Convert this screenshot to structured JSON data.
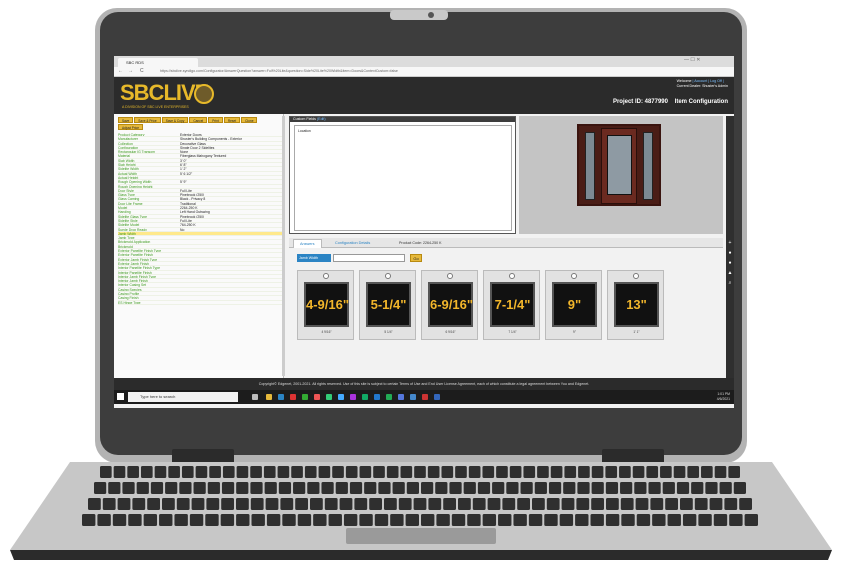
{
  "browser": {
    "tab_title": "SBC RDS",
    "url": "https://sbclive.syndigo.com/Configurator/AnswerQuestion?answer=Full%20Lite&question=Side%20Lite%20Width&item=Doors&ContextCustom=false",
    "back_glyph": "←",
    "forward_glyph": "→",
    "refresh_glyph": "C",
    "window_controls": "—   ☐   ✕"
  },
  "header": {
    "logo_text": "SBCLIVE",
    "logo_tagline": "A DIVISION OF SBC LIVE ENTERPRISES",
    "welcome": "Welcome",
    "account_links": "| Account | Log Off |",
    "current_dealer": "Current Dealer: Shuster's Admin",
    "project_id": "Project ID: 4877990",
    "item_configuration": "Item Configuration"
  },
  "toolbar": {
    "buttons": [
      "Save",
      "Save & Price",
      "Save & Copy",
      "Cancel",
      "Print",
      "Reset",
      "Clone",
      "Adjust Price"
    ]
  },
  "properties": [
    {
      "key": "Product Category",
      "value": "Exterior Doors"
    },
    {
      "key": "Manufacturer",
      "value": "Shuster's Building Components - Exterior"
    },
    {
      "key": "Collection",
      "value": "Decorative Glass"
    },
    {
      "key": "Configuration",
      "value": "Single Door 2 Sidelites"
    },
    {
      "key": "Rectangular IG Transom",
      "value": "None"
    },
    {
      "key": "Material",
      "value": "Fiberglass Mahogany Textured"
    },
    {
      "key": "Slab Width",
      "value": "3' 0\""
    },
    {
      "key": "Slab Height",
      "value": "6' 8\""
    },
    {
      "key": "Sidelite Width",
      "value": "1' 2\""
    },
    {
      "key": "Actual Width",
      "value": "5' 6 1/2\""
    },
    {
      "key": "Actual Height",
      "value": ""
    },
    {
      "key": "Rough Opening Width",
      "value": "5' 9\""
    },
    {
      "key": "Rough Opening Height",
      "value": ""
    },
    {
      "key": "Door Style",
      "value": "Full Lite"
    },
    {
      "key": "Glass Type",
      "value": "Pinebrook (250)"
    },
    {
      "key": "Glass Caming",
      "value": "Black - Privacy 8"
    },
    {
      "key": "Door Lite Frame",
      "value": "Traditional"
    },
    {
      "key": "Model",
      "value": "2264-250 K"
    },
    {
      "key": "Handing",
      "value": "Left Hand Outswing"
    },
    {
      "key": "Sidelite Glass Type",
      "value": "Pinebrook (250)"
    },
    {
      "key": "Sidelite Style",
      "value": "Full Lite"
    },
    {
      "key": "Sidelite Model",
      "value": "764-250 K"
    },
    {
      "key": "Suede Drop Ready",
      "value": "No"
    },
    {
      "key": "Jamb Width",
      "value": ""
    },
    {
      "key": "Jamb Type",
      "value": ""
    },
    {
      "key": "Brickmold Application",
      "value": ""
    },
    {
      "key": "Brickmold",
      "value": ""
    },
    {
      "key": "Exterior Panelite Finish Type",
      "value": ""
    },
    {
      "key": "Exterior Panelite Finish",
      "value": ""
    },
    {
      "key": "Exterior Jamb Finish Type",
      "value": ""
    },
    {
      "key": "Exterior Jamb Finish",
      "value": ""
    },
    {
      "key": "Interior Panelite Finish Type",
      "value": ""
    },
    {
      "key": "Interior Panelite Finish",
      "value": ""
    },
    {
      "key": "Interior Jamb Finish Type",
      "value": ""
    },
    {
      "key": "Interior Jamb Finish",
      "value": ""
    },
    {
      "key": "Interior Casing Set",
      "value": ""
    },
    {
      "key": "Casing Species",
      "value": ""
    },
    {
      "key": "Casing Profile",
      "value": ""
    },
    {
      "key": "Casing Finish",
      "value": ""
    },
    {
      "key": "ES Hinge Type",
      "value": ""
    }
  ],
  "custom_fields": {
    "title": "Custom Fields",
    "title_hint": "(Edit)",
    "location_label": "Location"
  },
  "answers": {
    "tab_answers": "Answers",
    "tab_config_details": "Configuration Details",
    "product_code": "Product Code: 2264-250 K",
    "filter_label": "Jamb Width",
    "filter_value": "",
    "filter_button": "Go",
    "options": [
      {
        "label": "4-9/16\"",
        "caption": "4 9/16\""
      },
      {
        "label": "5-1/4\"",
        "caption": "5 1/4\""
      },
      {
        "label": "6-9/16\"",
        "caption": "6 9/16\""
      },
      {
        "label": "7-1/4\"",
        "caption": "7 1/4\""
      },
      {
        "label": "9\"",
        "caption": "9\""
      },
      {
        "label": "13\"",
        "caption": "1' 1\""
      }
    ]
  },
  "footer": {
    "text": "Copyright© Edgenet, 2001-2021. All rights reserved. Use of this site is subject to certain Terms of Use and End User License Agreement, each of which constitute a legal agreement between You and Edgenet."
  },
  "taskbar": {
    "search_placeholder": "Type here to search",
    "clock_time": "1:01 PM",
    "clock_date": "4/6/2021"
  },
  "colors": {
    "accent_gold": "#e6b93b",
    "link_blue": "#2b84c4",
    "label_green": "#3c9a1d",
    "header_dark": "#2b2b2b"
  }
}
